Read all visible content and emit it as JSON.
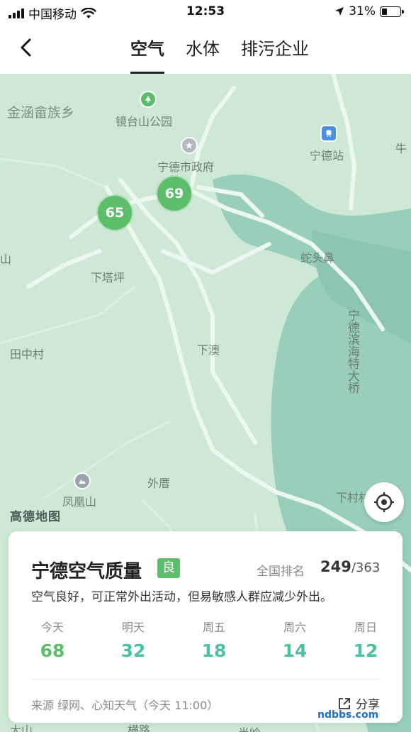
{
  "status_bar": {
    "carrier": "中国移动",
    "time": "12:53",
    "battery": "31%",
    "battery_level": 0.31
  },
  "nav": {
    "tabs": [
      {
        "label": "空气",
        "active": true
      },
      {
        "label": "水体",
        "active": false
      },
      {
        "label": "排污企业",
        "active": false
      }
    ]
  },
  "map": {
    "labels": {
      "jinhan": "金涵畲族乡",
      "jingtaishan": "镜台山公园",
      "gov": "宁德市政府",
      "station": "宁德站",
      "niu": "牛",
      "shan": "山",
      "shetoubi": "蛇头鼻",
      "xiatapin": "下塔坪",
      "bridge": "宁德滨海特大桥",
      "tianzhongcun": "田中村",
      "xiaao": "下澳",
      "waicuo": "外厝",
      "fenghuangshan": "凤凰山",
      "xiacun": "下村村",
      "bottom_left": "大山",
      "bottom_mid": "横路",
      "bottom_right": "半岭"
    },
    "logo": "高德地图",
    "markers": [
      {
        "value": "69"
      },
      {
        "value": "65"
      }
    ],
    "colors": {
      "land": "#cde9d6",
      "water": "#8fc7b6",
      "road": "#ecf7ef",
      "marker": "#5cbd6a"
    }
  },
  "card": {
    "title": "宁德空气质量",
    "level": "良",
    "rank_label": "全国排名",
    "rank": "249",
    "rank_total": "/363",
    "description": "空气良好，可正常外出活动，但易敏感人群应减少外出。",
    "forecast": [
      {
        "day": "今天",
        "value": "68",
        "color": "#5cbd6a"
      },
      {
        "day": "明天",
        "value": "32",
        "color": "#4fc1a3"
      },
      {
        "day": "周五",
        "value": "18",
        "color": "#4fc1a3"
      },
      {
        "day": "周六",
        "value": "14",
        "color": "#4fc1a3"
      },
      {
        "day": "周日",
        "value": "12",
        "color": "#4fc1a3"
      }
    ],
    "source": "来源 绿网、心知天气（今天 11:00）",
    "share_label": "分享"
  },
  "watermark": "ndbbs.com"
}
